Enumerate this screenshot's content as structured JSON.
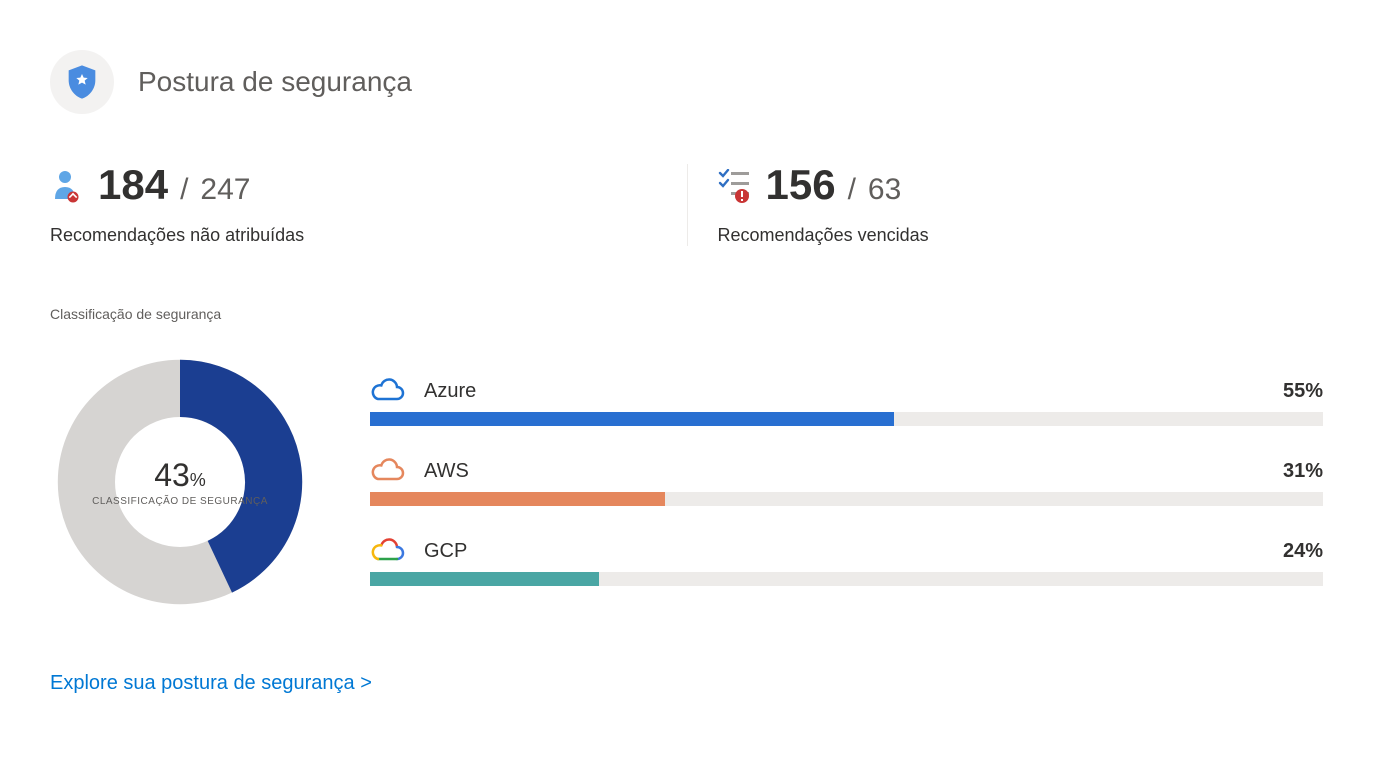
{
  "header": {
    "title": "Postura de segurança"
  },
  "stats": {
    "unassigned": {
      "big": "184",
      "small": "247",
      "label": "Recomendações não atribuídas"
    },
    "overdue": {
      "big": "156",
      "small": "63",
      "label": "Recomendações vencidas"
    }
  },
  "section_label": "Classificação de segurança",
  "donut": {
    "pct_value": "43",
    "pct_sym": "%",
    "sub": "CLASSIFICAÇÃO DE SEGURANÇA"
  },
  "clouds": [
    {
      "name": "Azure",
      "pct": 55,
      "pct_label": "55%",
      "color": "#286fd1"
    },
    {
      "name": "AWS",
      "pct": 31,
      "pct_label": "31%",
      "color": "#e5875d"
    },
    {
      "name": "GCP",
      "pct": 24,
      "pct_label": "24%",
      "color": "#4aa6a4"
    }
  ],
  "explore_link": "Explore sua postura de segurança >",
  "chart_data": {
    "type": "bar",
    "title": "Classificação de segurança",
    "categories": [
      "Azure",
      "AWS",
      "GCP"
    ],
    "values": [
      55,
      31,
      24
    ],
    "ylim": [
      0,
      100
    ],
    "donut_value": 43,
    "donut_label": "CLASSIFICAÇÃO DE SEGURANÇA"
  }
}
